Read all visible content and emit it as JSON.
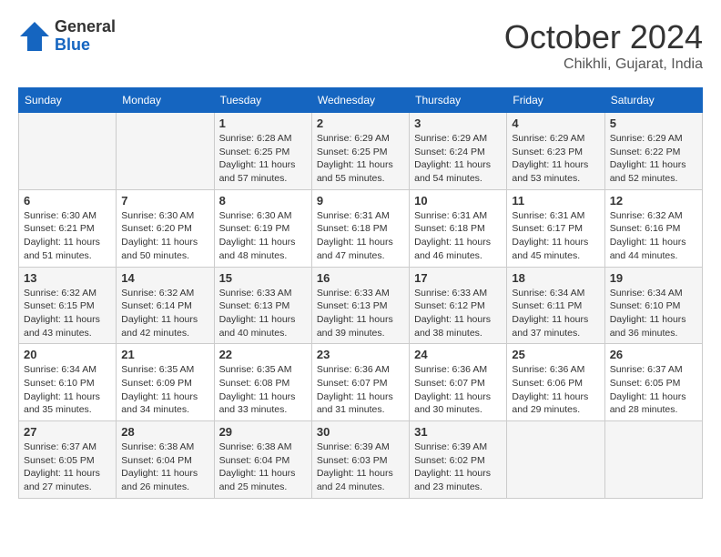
{
  "header": {
    "logo_general": "General",
    "logo_blue": "Blue",
    "month": "October 2024",
    "location": "Chikhli, Gujarat, India"
  },
  "weekdays": [
    "Sunday",
    "Monday",
    "Tuesday",
    "Wednesday",
    "Thursday",
    "Friday",
    "Saturday"
  ],
  "weeks": [
    [
      {
        "day": "",
        "content": ""
      },
      {
        "day": "",
        "content": ""
      },
      {
        "day": "1",
        "content": "Sunrise: 6:28 AM\nSunset: 6:25 PM\nDaylight: 11 hours and 57 minutes."
      },
      {
        "day": "2",
        "content": "Sunrise: 6:29 AM\nSunset: 6:25 PM\nDaylight: 11 hours and 55 minutes."
      },
      {
        "day": "3",
        "content": "Sunrise: 6:29 AM\nSunset: 6:24 PM\nDaylight: 11 hours and 54 minutes."
      },
      {
        "day": "4",
        "content": "Sunrise: 6:29 AM\nSunset: 6:23 PM\nDaylight: 11 hours and 53 minutes."
      },
      {
        "day": "5",
        "content": "Sunrise: 6:29 AM\nSunset: 6:22 PM\nDaylight: 11 hours and 52 minutes."
      }
    ],
    [
      {
        "day": "6",
        "content": "Sunrise: 6:30 AM\nSunset: 6:21 PM\nDaylight: 11 hours and 51 minutes."
      },
      {
        "day": "7",
        "content": "Sunrise: 6:30 AM\nSunset: 6:20 PM\nDaylight: 11 hours and 50 minutes."
      },
      {
        "day": "8",
        "content": "Sunrise: 6:30 AM\nSunset: 6:19 PM\nDaylight: 11 hours and 48 minutes."
      },
      {
        "day": "9",
        "content": "Sunrise: 6:31 AM\nSunset: 6:18 PM\nDaylight: 11 hours and 47 minutes."
      },
      {
        "day": "10",
        "content": "Sunrise: 6:31 AM\nSunset: 6:18 PM\nDaylight: 11 hours and 46 minutes."
      },
      {
        "day": "11",
        "content": "Sunrise: 6:31 AM\nSunset: 6:17 PM\nDaylight: 11 hours and 45 minutes."
      },
      {
        "day": "12",
        "content": "Sunrise: 6:32 AM\nSunset: 6:16 PM\nDaylight: 11 hours and 44 minutes."
      }
    ],
    [
      {
        "day": "13",
        "content": "Sunrise: 6:32 AM\nSunset: 6:15 PM\nDaylight: 11 hours and 43 minutes."
      },
      {
        "day": "14",
        "content": "Sunrise: 6:32 AM\nSunset: 6:14 PM\nDaylight: 11 hours and 42 minutes."
      },
      {
        "day": "15",
        "content": "Sunrise: 6:33 AM\nSunset: 6:13 PM\nDaylight: 11 hours and 40 minutes."
      },
      {
        "day": "16",
        "content": "Sunrise: 6:33 AM\nSunset: 6:13 PM\nDaylight: 11 hours and 39 minutes."
      },
      {
        "day": "17",
        "content": "Sunrise: 6:33 AM\nSunset: 6:12 PM\nDaylight: 11 hours and 38 minutes."
      },
      {
        "day": "18",
        "content": "Sunrise: 6:34 AM\nSunset: 6:11 PM\nDaylight: 11 hours and 37 minutes."
      },
      {
        "day": "19",
        "content": "Sunrise: 6:34 AM\nSunset: 6:10 PM\nDaylight: 11 hours and 36 minutes."
      }
    ],
    [
      {
        "day": "20",
        "content": "Sunrise: 6:34 AM\nSunset: 6:10 PM\nDaylight: 11 hours and 35 minutes."
      },
      {
        "day": "21",
        "content": "Sunrise: 6:35 AM\nSunset: 6:09 PM\nDaylight: 11 hours and 34 minutes."
      },
      {
        "day": "22",
        "content": "Sunrise: 6:35 AM\nSunset: 6:08 PM\nDaylight: 11 hours and 33 minutes."
      },
      {
        "day": "23",
        "content": "Sunrise: 6:36 AM\nSunset: 6:07 PM\nDaylight: 11 hours and 31 minutes."
      },
      {
        "day": "24",
        "content": "Sunrise: 6:36 AM\nSunset: 6:07 PM\nDaylight: 11 hours and 30 minutes."
      },
      {
        "day": "25",
        "content": "Sunrise: 6:36 AM\nSunset: 6:06 PM\nDaylight: 11 hours and 29 minutes."
      },
      {
        "day": "26",
        "content": "Sunrise: 6:37 AM\nSunset: 6:05 PM\nDaylight: 11 hours and 28 minutes."
      }
    ],
    [
      {
        "day": "27",
        "content": "Sunrise: 6:37 AM\nSunset: 6:05 PM\nDaylight: 11 hours and 27 minutes."
      },
      {
        "day": "28",
        "content": "Sunrise: 6:38 AM\nSunset: 6:04 PM\nDaylight: 11 hours and 26 minutes."
      },
      {
        "day": "29",
        "content": "Sunrise: 6:38 AM\nSunset: 6:04 PM\nDaylight: 11 hours and 25 minutes."
      },
      {
        "day": "30",
        "content": "Sunrise: 6:39 AM\nSunset: 6:03 PM\nDaylight: 11 hours and 24 minutes."
      },
      {
        "day": "31",
        "content": "Sunrise: 6:39 AM\nSunset: 6:02 PM\nDaylight: 11 hours and 23 minutes."
      },
      {
        "day": "",
        "content": ""
      },
      {
        "day": "",
        "content": ""
      }
    ]
  ]
}
